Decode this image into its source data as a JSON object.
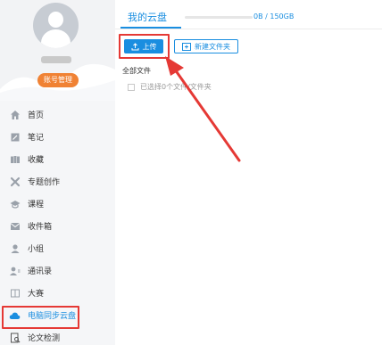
{
  "profile": {
    "account_button": "账号管理"
  },
  "nav": {
    "items": [
      {
        "label": "首页",
        "icon": "home-icon"
      },
      {
        "label": "笔记",
        "icon": "note-icon"
      },
      {
        "label": "收藏",
        "icon": "bookmark-icon"
      },
      {
        "label": "专题创作",
        "icon": "tools-icon"
      },
      {
        "label": "课程",
        "icon": "graduation-cap-icon"
      },
      {
        "label": "收件箱",
        "icon": "inbox-icon"
      },
      {
        "label": "小组",
        "icon": "group-icon"
      },
      {
        "label": "通讯录",
        "icon": "contacts-icon"
      },
      {
        "label": "大赛",
        "icon": "book-icon"
      },
      {
        "label": "电脑同步云盘",
        "icon": "cloud-icon",
        "active": true
      },
      {
        "label": "论文检测",
        "icon": "paper-check-icon"
      }
    ]
  },
  "main": {
    "tab_label": "我的云盘",
    "storage_text": "0B / 150GB",
    "storage_used": 0,
    "upload_label": "上传",
    "new_folder_label": "新建文件夹",
    "all_files_label": "全部文件",
    "selection_text": "已选择0个文件/文件夹"
  },
  "colors": {
    "accent": "#1a8ee0",
    "highlight": "#e53935",
    "account_button": "#f08234"
  }
}
